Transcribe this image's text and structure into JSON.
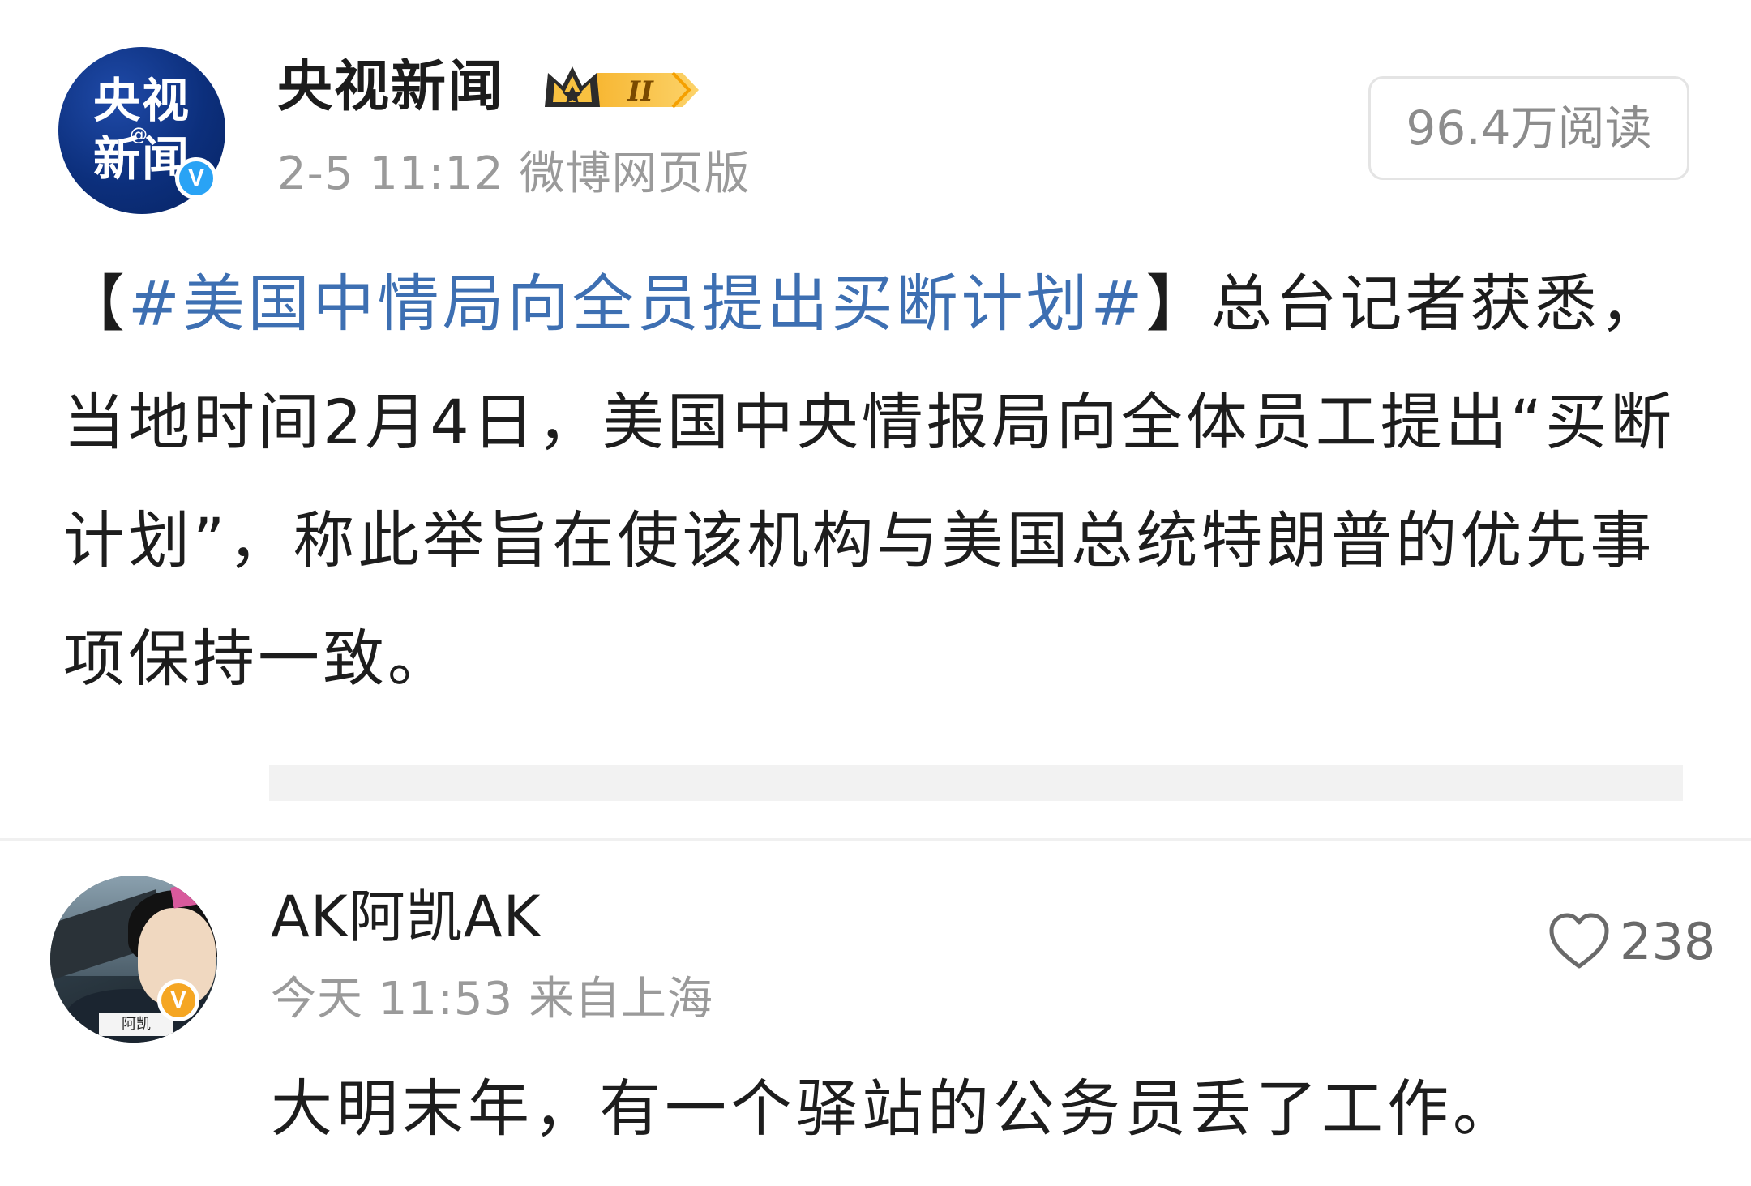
{
  "post": {
    "avatar": {
      "logo_line1": "央视",
      "logo_line2": "新闻",
      "logo_at": "@",
      "verified_icon": "verified-blue-icon",
      "verified_mark": "V"
    },
    "author_name": "央视新闻",
    "crown_badge": {
      "icon": "crown-icon",
      "level": "II"
    },
    "meta": "2-5 11:12 微博网页版",
    "read_count": "96.4万阅读",
    "body": {
      "bracket_open": "【",
      "hashtag": "#美国中情局向全员提出买断计划#",
      "bracket_close": "】",
      "text": "总台记者获悉，当地时间2月4日，美国中央情报局向全体员工提出“买断计划”，称此举旨在使该机构与美国总统特朗普的优先事项保持一致。"
    }
  },
  "comment": {
    "avatar": {
      "tag": "阿凯",
      "verified_icon": "verified-gold-icon",
      "verified_mark": "V"
    },
    "name": "AK阿凯AK",
    "meta": "今天 11:53 来自上海",
    "like_icon": "heart-icon",
    "like_count": "238",
    "text": "大明末年，有一个驿站的公务员丢了工作。"
  },
  "colors": {
    "hashtag": "#3d6fb2",
    "verified_blue": "#29a3f5",
    "verified_gold": "#f5a623",
    "meta_gray": "#9a9a9a",
    "cctv_blue": "#0c2f7c"
  }
}
